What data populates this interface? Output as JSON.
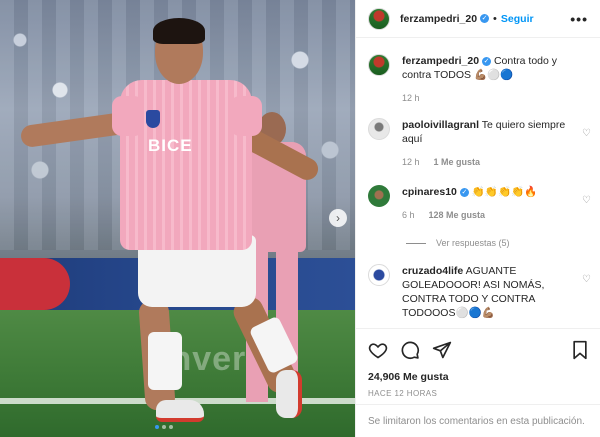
{
  "post": {
    "username": "ferzampedri_20",
    "separator": "•",
    "follow_label": "Seguir",
    "more_label": "•••",
    "verified_mark": "✓",
    "photo_text": {
      "shirt_sponsor": "BICE",
      "board_text": "inversio"
    },
    "carousel": {
      "next_arrow": "›",
      "total_slides": 3,
      "current_slide": 1
    }
  },
  "comments": [
    {
      "username": "ferzampedri_20",
      "verified": true,
      "text": "Contra todo y contra TODOS 💪🏽⚪️🔵",
      "time": "12 h",
      "likes": ""
    },
    {
      "username": "paoloivillagranl",
      "verified": false,
      "text": "Te quiero siempre aquí",
      "time": "12 h",
      "likes": "1 Me gusta"
    },
    {
      "username": "cpinares10",
      "verified": true,
      "text": "👏👏👏👏🔥",
      "time": "6 h",
      "likes": "128 Me gusta"
    },
    {
      "username": "cruzado4life",
      "verified": false,
      "text": "AGUANTE GOLEADOOOR! ASI NOMÁS, CONTRA TODO Y CONTRA TODOOOS⚪️🔵💪🏽",
      "time": "",
      "likes": ""
    }
  ],
  "replies_label": "Ver respuestas (5)",
  "actions": {
    "like_count": "24,906 Me gusta",
    "timestamp": "HACE 12 HORAS",
    "comments_closed": "Se limitaron los comentarios en esta publicación."
  },
  "colors": {
    "accent": "#0095f6",
    "verified": "#3897f0",
    "muted": "#8e8e8e"
  }
}
